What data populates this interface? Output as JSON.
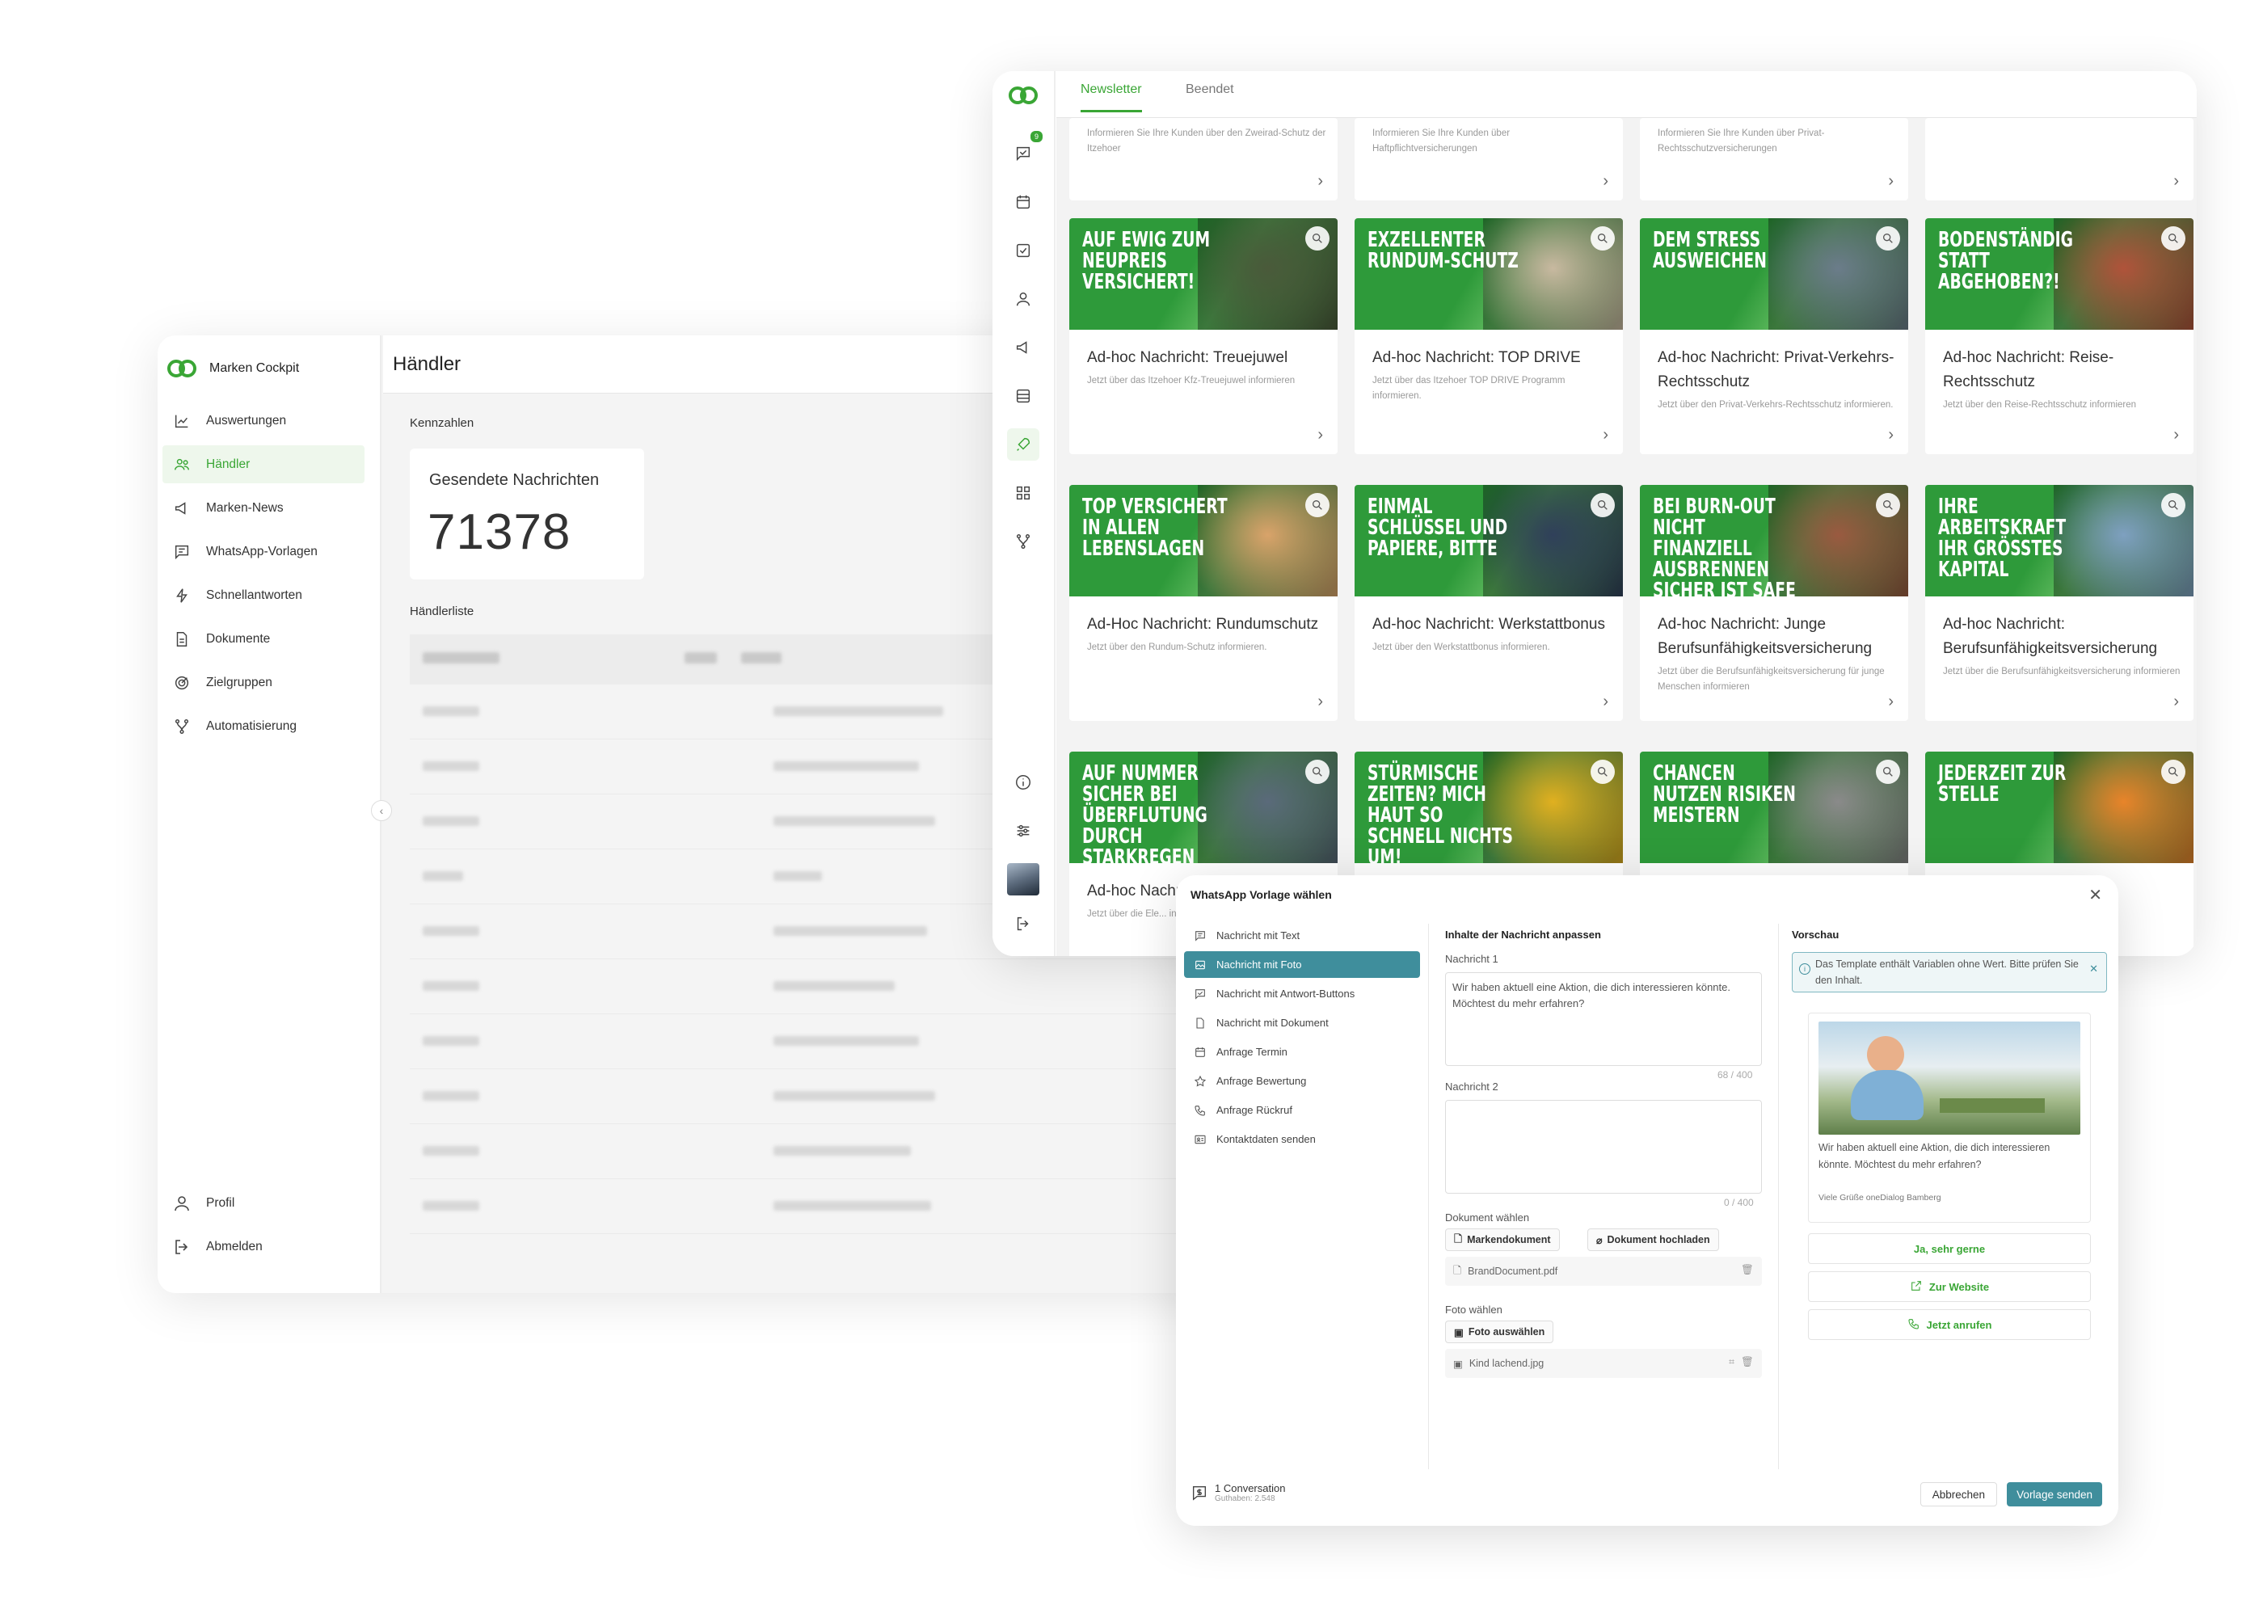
{
  "cockpit": {
    "brand": "Marken Cockpit",
    "nav": [
      {
        "label": "Auswertungen",
        "icon": "chart-line-icon"
      },
      {
        "label": "Händler",
        "icon": "users-icon",
        "active": true
      },
      {
        "label": "Marken-News",
        "icon": "megaphone-icon"
      },
      {
        "label": "WhatsApp-Vorlagen",
        "icon": "message-template-icon"
      },
      {
        "label": "Schnellantworten",
        "icon": "lightning-icon"
      },
      {
        "label": "Dokumente",
        "icon": "document-icon"
      },
      {
        "label": "Zielgruppen",
        "icon": "target-icon"
      },
      {
        "label": "Automatisierung",
        "icon": "branch-icon"
      }
    ],
    "profile": "Profil",
    "logout": "Abmelden",
    "page_title": "Händler",
    "kpi_section": "Kennzahlen",
    "kpi_label": "Gesendete Nachrichten",
    "kpi_value": "71378",
    "list_section": "Händlerliste"
  },
  "newsletter": {
    "tabs": [
      "Newsletter",
      "Beendet"
    ],
    "badge": "9",
    "top_cards": [
      {
        "desc": "Informieren Sie Ihre Kunden über den Zweirad-Schutz der Itzehoer"
      },
      {
        "desc": "Informieren Sie Ihre Kunden über Haftpflichtversicherungen"
      },
      {
        "desc": "Informieren Sie Ihre Kunden über Privat-Rechtsschutzversicherungen"
      },
      {
        "desc": ""
      }
    ],
    "cards": [
      {
        "headline": "Auf ewig zum Neupreis versichert!",
        "title": "Ad-hoc Nachricht: Treuejuwel",
        "desc": "Jetzt über das Itzehoer Kfz-Treuejuwel informieren",
        "c1": "#2e9a3a",
        "c2": "#4a5a3a"
      },
      {
        "headline": "Exzellenter Rundum-Schutz",
        "title": "Ad-hoc Nachricht: TOP DRIVE",
        "desc": "Jetzt über das Itzehoer TOP DRIVE Programm informieren.",
        "c1": "#2e9a3a",
        "c2": "#c8b9a0"
      },
      {
        "headline": "Dem Stress ausweichen",
        "title": "Ad-hoc Nachricht: Privat-Verkehrs-Rechtsschutz",
        "desc": "Jetzt über den Privat-Verkehrs-Rechtsschutz informieren.",
        "c1": "#2e9a3a",
        "c2": "#6b7c8a"
      },
      {
        "headline": "Bodenständig statt abgehoben?!",
        "title": "Ad-hoc Nachricht: Reise-Rechtsschutz",
        "desc": "Jetzt über den Reise-Rechtsschutz informieren",
        "c1": "#2e9a3a",
        "c2": "#b0533a"
      },
      {
        "headline": "Top versichert in allen Lebenslagen",
        "title": "Ad-Hoc Nachricht: Rundumschutz",
        "desc": "Jetzt über den Rundum-Schutz informieren.",
        "c1": "#2e9a3a",
        "c2": "#d9a36a"
      },
      {
        "headline": "Einmal Schlüssel und Papiere, bitte",
        "title": "Ad-hoc Nachricht: Werkstattbonus",
        "desc": "Jetzt über den Werkstattbonus informieren.",
        "c1": "#2e9a3a",
        "c2": "#30405a"
      },
      {
        "headline": "Bei Burn-out nicht finanziell ausbrennen Sicher ist safe",
        "title": "Ad-hoc Nachricht: Junge Berufsunfähigkeitsversicherung",
        "desc": "Jetzt über die Berufsunfähigkeitsversicherung für junge Menschen informieren",
        "c1": "#2e9a3a",
        "c2": "#9a5a40"
      },
      {
        "headline": "Ihre Arbeitskraft Ihr größtes Kapital",
        "title": "Ad-hoc Nachricht: Berufsunfähigkeitsversicherung",
        "desc": "Jetzt über die Berufsunfähigkeitsversicherung informieren",
        "c1": "#2e9a3a",
        "c2": "#7ea0c0"
      },
      {
        "headline": "Auf Nummer sicher bei Überflutung durch Starkregen",
        "title": "Ad-hoc Nachricht",
        "desc": "Jetzt über die Ele... informieren",
        "c1": "#2e9a3a",
        "c2": "#5a6a7a"
      },
      {
        "headline": "Stürmische Zeiten? Mich haut so schnell nichts um!",
        "title": "",
        "desc": "",
        "c1": "#2e9a3a",
        "c2": "#e0b020"
      },
      {
        "headline": "Chancen nutzen Risiken meistern",
        "title": "",
        "desc": "",
        "c1": "#2e9a3a",
        "c2": "#8a8a8a"
      },
      {
        "headline": "Jederzeit zur Stelle",
        "title": "",
        "desc": "...ieren",
        "c1": "#2e9a3a",
        "c2": "#e8842a"
      }
    ]
  },
  "modal": {
    "title": "WhatsApp Vorlage wählen",
    "types": [
      {
        "label": "Nachricht mit Text",
        "icon": "message-text-icon"
      },
      {
        "label": "Nachricht mit Foto",
        "icon": "message-image-icon",
        "active": true
      },
      {
        "label": "Nachricht mit Antwort-Buttons",
        "icon": "message-check-icon"
      },
      {
        "label": "Nachricht mit Dokument",
        "icon": "file-icon"
      },
      {
        "label": "Anfrage Termin",
        "icon": "calendar-icon"
      },
      {
        "label": "Anfrage Bewertung",
        "icon": "star-icon"
      },
      {
        "label": "Anfrage Rückruf",
        "icon": "phone-icon"
      },
      {
        "label": "Kontaktdaten senden",
        "icon": "contact-card-icon"
      }
    ],
    "content_heading": "Inhalte der Nachricht anpassen",
    "msg1_label": "Nachricht 1",
    "msg1_value": "Wir haben aktuell eine Aktion, die dich interessieren könnte. Möchtest du mehr erfahren?",
    "msg1_count": "68 / 400",
    "msg2_label": "Nachricht 2",
    "msg2_value": "",
    "msg2_count": "0 / 400",
    "doc_label": "Dokument wählen",
    "btn_brand_doc": "Markendokument",
    "btn_upload_doc": "Dokument hochladen",
    "doc_file": "BrandDocument.pdf",
    "photo_label": "Foto wählen",
    "btn_photo": "Foto auswählen",
    "photo_file": "Kind lachend.jpg",
    "preview_heading": "Vorschau",
    "alert": "Das Template enthält Variablen ohne Wert. Bitte prüfen Sie den Inhalt.",
    "preview_text": "Wir haben aktuell eine Aktion, die dich interessieren könnte. Möchtest du mehr erfahren?",
    "preview_sig": "Viele Grüße oneDialog Bamberg",
    "quick_buttons": [
      {
        "label": "Ja, sehr gerne",
        "icon": ""
      },
      {
        "label": "Zur Website",
        "icon": "external-link-icon"
      },
      {
        "label": "Jetzt anrufen",
        "icon": "phone-icon"
      }
    ],
    "conversation": "1 Conversation",
    "credit": "Guthaben: 2.548",
    "cancel": "Abbrechen",
    "send": "Vorlage senden"
  }
}
